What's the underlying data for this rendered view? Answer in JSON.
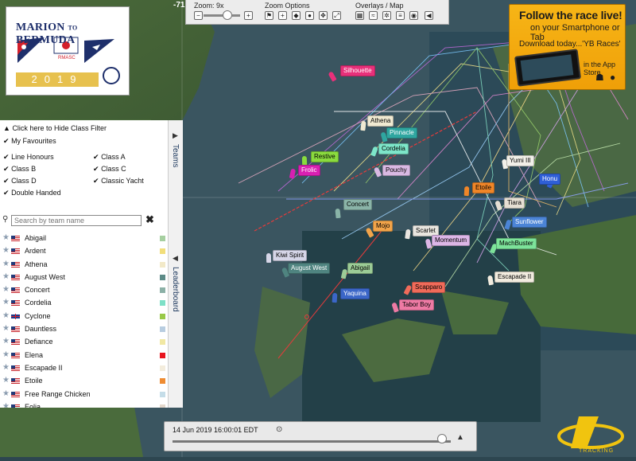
{
  "logo": {
    "line1": "MARION",
    "line1_to": "TO",
    "line1_end": "BERMUDA",
    "club": "RMASC",
    "year": "2019"
  },
  "coord_fragment": "-71.",
  "toolbar": {
    "zoom_label": "Zoom: 9x",
    "zoom_options_label": "Zoom Options",
    "overlays_label": "Overlays / Map",
    "zoom_minus": "−",
    "zoom_plus": "+",
    "zoom_level_fraction": 0.65
  },
  "ad": {
    "line1": "Follow the race live!",
    "line2": "on your Smartphone or Tab",
    "line3": "Download today...'YB Races'",
    "line4": "in the App Store"
  },
  "filter": {
    "hide_label": "Click here to Hide Class Filter",
    "my_favourites": "My Favourites",
    "classes": [
      "Line Honours",
      "Class A",
      "Class B",
      "Class C",
      "Class D",
      "Classic Yacht",
      "Double Handed"
    ]
  },
  "search": {
    "placeholder": "Search by team name"
  },
  "side_tabs": {
    "teams": "Teams",
    "leaderboard": "Leaderboard"
  },
  "teams": [
    {
      "name": "Abigail",
      "flag": "us",
      "color": "#a6cfa0"
    },
    {
      "name": "Ardent",
      "flag": "us",
      "color": "#f2de7a"
    },
    {
      "name": "Athena",
      "flag": "us",
      "color": "#f2e9c8"
    },
    {
      "name": "August West",
      "flag": "us",
      "color": "#5c8a86"
    },
    {
      "name": "Concert",
      "flag": "us",
      "color": "#8bb0a6"
    },
    {
      "name": "Cordelia",
      "flag": "us",
      "color": "#7ee0c7"
    },
    {
      "name": "Cyclone",
      "flag": "gb",
      "color": "#99c948"
    },
    {
      "name": "Dauntless",
      "flag": "us",
      "color": "#b8cde0"
    },
    {
      "name": "Defiance",
      "flag": "us",
      "color": "#f1e8a3"
    },
    {
      "name": "Elena",
      "flag": "us",
      "color": "#e8151f"
    },
    {
      "name": "Escapade II",
      "flag": "us",
      "color": "#f3ecdc"
    },
    {
      "name": "Etoile",
      "flag": "us",
      "color": "#ef8c32"
    },
    {
      "name": "Free Range Chicken",
      "flag": "us",
      "color": "#c5dde8"
    },
    {
      "name": "Eolia",
      "flag": "us",
      "color": "#e4d8cc"
    }
  ],
  "timeline": {
    "date": "14 Jun 2019 16:00:01 EDT",
    "position_fraction": 0.97
  },
  "yb_logo_text": "TRACKING",
  "boats": [
    {
      "name": "Silhouette",
      "bg": "#e8307a",
      "fg": "#fff"
    },
    {
      "name": "Athena",
      "bg": "#f0ead2",
      "fg": "#000"
    },
    {
      "name": "Pinnacle",
      "bg": "#2fa6a0",
      "fg": "#fff"
    },
    {
      "name": "Cordelia",
      "bg": "#7de6c9",
      "fg": "#000"
    },
    {
      "name": "Restive",
      "bg": "#8adb3e",
      "fg": "#000"
    },
    {
      "name": "Pouchy",
      "bg": "#d9b9e3",
      "fg": "#000"
    },
    {
      "name": "Frolic",
      "bg": "#d820b2",
      "fg": "#fff"
    },
    {
      "name": "Yumi III",
      "bg": "#f2f0e9",
      "fg": "#000"
    },
    {
      "name": "Honu",
      "bg": "#2f5fd8",
      "fg": "#fff"
    },
    {
      "name": "Etoile",
      "bg": "#f08628",
      "fg": "#000"
    },
    {
      "name": "Tiara",
      "bg": "#e6dfd3",
      "fg": "#000"
    },
    {
      "name": "Sunflower",
      "bg": "#4b84d6",
      "fg": "#fff"
    },
    {
      "name": "Concert",
      "bg": "#8ab4a8",
      "fg": "#000"
    },
    {
      "name": "Mojo",
      "bg": "#f2a44a",
      "fg": "#000"
    },
    {
      "name": "Scarlet",
      "bg": "#e9e6e0",
      "fg": "#000"
    },
    {
      "name": "Momentum",
      "bg": "#dcb6e6",
      "fg": "#000"
    },
    {
      "name": "MachBuster",
      "bg": "#7de39a",
      "fg": "#000"
    },
    {
      "name": "Kiwi Spirit",
      "bg": "#d6d6e8",
      "fg": "#000"
    },
    {
      "name": "August West",
      "bg": "#4f8480",
      "fg": "#fff"
    },
    {
      "name": "Abigail",
      "bg": "#9ccc96",
      "fg": "#000"
    },
    {
      "name": "Escapade II",
      "bg": "#f2ecdf",
      "fg": "#000"
    },
    {
      "name": "Scapparo",
      "bg": "#f16b5a",
      "fg": "#000"
    },
    {
      "name": "Yaquina",
      "bg": "#3b66c8",
      "fg": "#fff"
    },
    {
      "name": "Tabor Boy",
      "bg": "#ee7aa4",
      "fg": "#000"
    }
  ]
}
